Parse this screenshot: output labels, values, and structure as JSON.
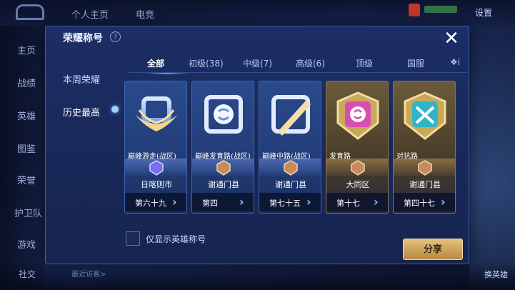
{
  "background": {
    "top_tabs": [
      "个人主页",
      "电竞"
    ],
    "settings_label": "设置",
    "left_nav": [
      "主页",
      "战绩",
      "英雄",
      "图鉴",
      "荣誉",
      "护卫队",
      "游戏",
      "社交"
    ],
    "recent_visitors": "最近访客>",
    "right_bottom_label": "换英雄"
  },
  "panel": {
    "title": "荣耀称号",
    "close_label": "✕"
  },
  "sidebar": {
    "items": [
      {
        "label": "本周荣耀"
      },
      {
        "label": "历史最高"
      }
    ]
  },
  "tabs": [
    {
      "label": "全部"
    },
    {
      "label": "初级(38)"
    },
    {
      "label": "中级(7)"
    },
    {
      "label": "高级(6)"
    },
    {
      "label": "顶级"
    },
    {
      "label": "国服"
    },
    {
      "label": "❖i"
    }
  ],
  "cards": [
    {
      "name": "巅峰游走(战区)",
      "region": "日喀则市",
      "rank": "第六十九",
      "icon": "winged-shield-icon"
    },
    {
      "name": "巅峰发育路(战区)",
      "region": "谢通门县",
      "rank": "第四",
      "icon": "s-emblem-icon"
    },
    {
      "name": "巅峰中路(战区)",
      "region": "谢通门县",
      "rank": "第七十五",
      "icon": "diagonal-blade-icon"
    },
    {
      "name": "发育路",
      "region": "大同区",
      "rank": "第十七",
      "icon": "pink-s-emblem-icon"
    },
    {
      "name": "对抗路",
      "region": "谢通门县",
      "rank": "第四十七",
      "icon": "crossed-swords-icon"
    }
  ],
  "filter": {
    "label": "仅显示英雄称号"
  },
  "share": {
    "label": "分享"
  }
}
